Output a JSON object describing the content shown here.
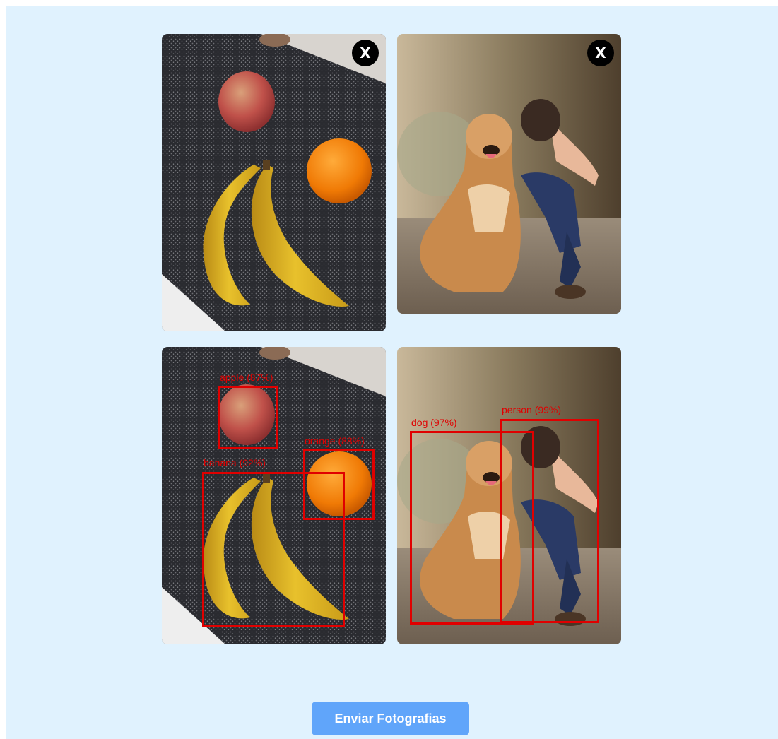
{
  "uploads": [
    {
      "image": "fruit-photo",
      "close_label": "X"
    },
    {
      "image": "dog-woman-photo",
      "close_label": "X"
    }
  ],
  "results": [
    {
      "image": "fruit-photo",
      "detections": [
        {
          "label": "apple (87%)"
        },
        {
          "label": "orange (88%)"
        },
        {
          "label": "banana (92%)"
        }
      ]
    },
    {
      "image": "dog-woman-photo",
      "detections": [
        {
          "label": "dog (97%)"
        },
        {
          "label": "person (99%)"
        }
      ]
    }
  ],
  "submit_label": "Enviar Fotografias",
  "colors": {
    "background": "#e0f2fe",
    "button": "#60a5fa",
    "detection": "#e00000"
  }
}
